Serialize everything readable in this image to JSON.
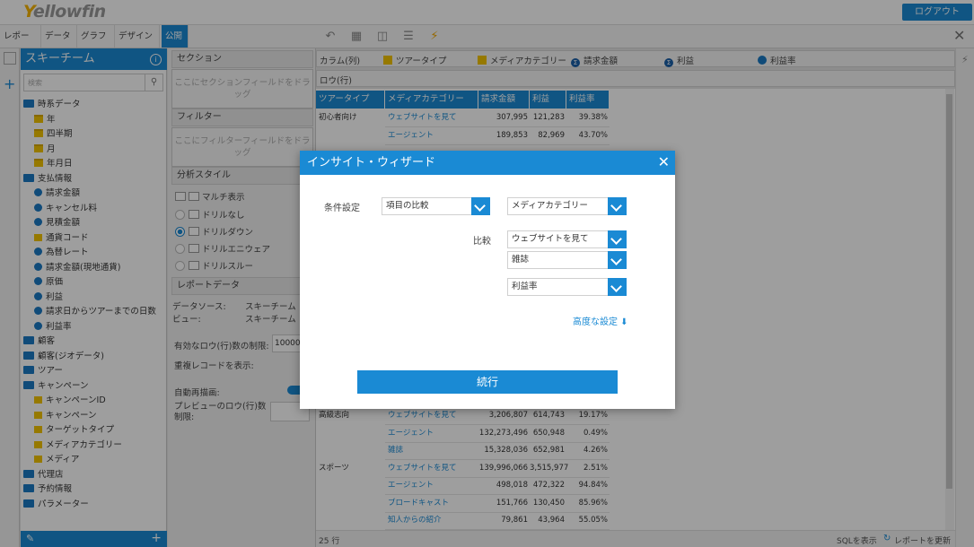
{
  "header": {
    "logo_y": "Y",
    "logo_rest": "ellowfin",
    "logout_label": "ログアウト"
  },
  "tabs": [
    "レポート",
    "データ",
    "グラフ",
    "デザイン",
    "公開"
  ],
  "sidebar": {
    "title": "スキーチーム",
    "search_placeholder": "検索",
    "items": [
      {
        "type": "folder",
        "label": "時系データ"
      },
      {
        "type": "cal",
        "label": "年"
      },
      {
        "type": "cal",
        "label": "四半期"
      },
      {
        "type": "cal",
        "label": "月"
      },
      {
        "type": "cal",
        "label": "年月日"
      },
      {
        "type": "folder",
        "label": "支払情報"
      },
      {
        "type": "dot",
        "label": "請求金額"
      },
      {
        "type": "dot",
        "label": "キャンセル料"
      },
      {
        "type": "dot",
        "label": "見積金額"
      },
      {
        "type": "sq",
        "label": "通貨コード"
      },
      {
        "type": "dot",
        "label": "為替レート"
      },
      {
        "type": "dot",
        "label": "請求金額(現地通貨)"
      },
      {
        "type": "dot",
        "label": "原価"
      },
      {
        "type": "dot",
        "label": "利益"
      },
      {
        "type": "dot",
        "label": "請求日からツアーまでの日数"
      },
      {
        "type": "dot",
        "label": "利益率"
      },
      {
        "type": "folder",
        "label": "顧客"
      },
      {
        "type": "folder",
        "label": "顧客(ジオデータ)"
      },
      {
        "type": "folder",
        "label": "ツアー"
      },
      {
        "type": "folder",
        "label": "キャンペーン"
      },
      {
        "type": "sq",
        "label": "キャンペーンID"
      },
      {
        "type": "sq",
        "label": "キャンペーン"
      },
      {
        "type": "sq",
        "label": "ターゲットタイプ"
      },
      {
        "type": "sq",
        "label": "メディアカテゴリー"
      },
      {
        "type": "sq",
        "label": "メディア"
      },
      {
        "type": "folder",
        "label": "代理店"
      },
      {
        "type": "folder",
        "label": "予約情報"
      },
      {
        "type": "folder",
        "label": "パラメーター"
      }
    ]
  },
  "middle": {
    "section_title": "セクション",
    "section_drop": "ここにセクションフィールドをドラッグ",
    "filter_title": "フィルター",
    "filter_drop": "ここにフィルターフィールドをドラッグ",
    "analysis_title": "分析スタイル",
    "multi": "マルチ表示",
    "styles": [
      "ドリルなし",
      "ドリルダウン",
      "ドリルエニウェア",
      "ドリルスルー"
    ],
    "reportdata_title": "レポートデータ",
    "source_label": "データソース:",
    "source_value": "スキーチーム",
    "view_label": "ビュー:",
    "view_value": "スキーチーム",
    "row_limit_label": "有効なロウ(行)数の制限:",
    "row_limit_value": "10000",
    "dup_label": "重複レコードを表示:",
    "auto_label": "自動再描画:",
    "preview_label": "プレビューのロウ(行)数制限:"
  },
  "fields": {
    "col_label": "カラム(列)",
    "row_label": "ロウ(行)",
    "columns": [
      {
        "kind": "sq",
        "label": "ツアータイプ"
      },
      {
        "kind": "sq",
        "label": "メディアカテゴリー"
      },
      {
        "kind": "sig",
        "label": "請求金額"
      },
      {
        "kind": "sig",
        "label": "利益"
      },
      {
        "kind": "dot",
        "label": "利益率"
      }
    ]
  },
  "table": {
    "headers": [
      "ツアータイプ",
      "メディアカテゴリー",
      "請求金額",
      "利益",
      "利益率"
    ],
    "rows_top": [
      [
        "初心者向け",
        "ウェブサイトを見て",
        "307,995",
        "121,283",
        "39.38%"
      ],
      [
        "",
        "エージェント",
        "189,853",
        "82,969",
        "43.70%"
      ]
    ],
    "rows_bottom": [
      [
        "高級志向",
        "ウェブサイトを見て",
        "3,206,807",
        "614,743",
        "19.17%"
      ],
      [
        "",
        "エージェント",
        "132,273,496",
        "650,948",
        "0.49%"
      ],
      [
        "",
        "雑誌",
        "15,328,036",
        "652,981",
        "4.26%"
      ],
      [
        "スポーツ",
        "ウェブサイトを見て",
        "139,996,066",
        "3,515,977",
        "2.51%"
      ],
      [
        "",
        "エージェント",
        "498,018",
        "472,322",
        "94.84%"
      ],
      [
        "",
        "ブロードキャスト",
        "151,766",
        "130,450",
        "85.96%"
      ],
      [
        "",
        "知人からの紹介",
        "79,861",
        "43,964",
        "55.05%"
      ]
    ]
  },
  "status": {
    "row_count": "25 行",
    "sql": "SQLを表示",
    "refresh": "レポートを更新"
  },
  "dialog": {
    "title": "インサイト・ウィザード",
    "condition_label": "条件設定",
    "condition_value": "項目の比較",
    "field_value": "メディアカテゴリー",
    "compare_label": "比較",
    "compare_values": [
      "ウェブサイトを見て",
      "雑誌"
    ],
    "metric_value": "利益率",
    "advanced": "高度な設定 ⬇",
    "continue": "続行"
  }
}
